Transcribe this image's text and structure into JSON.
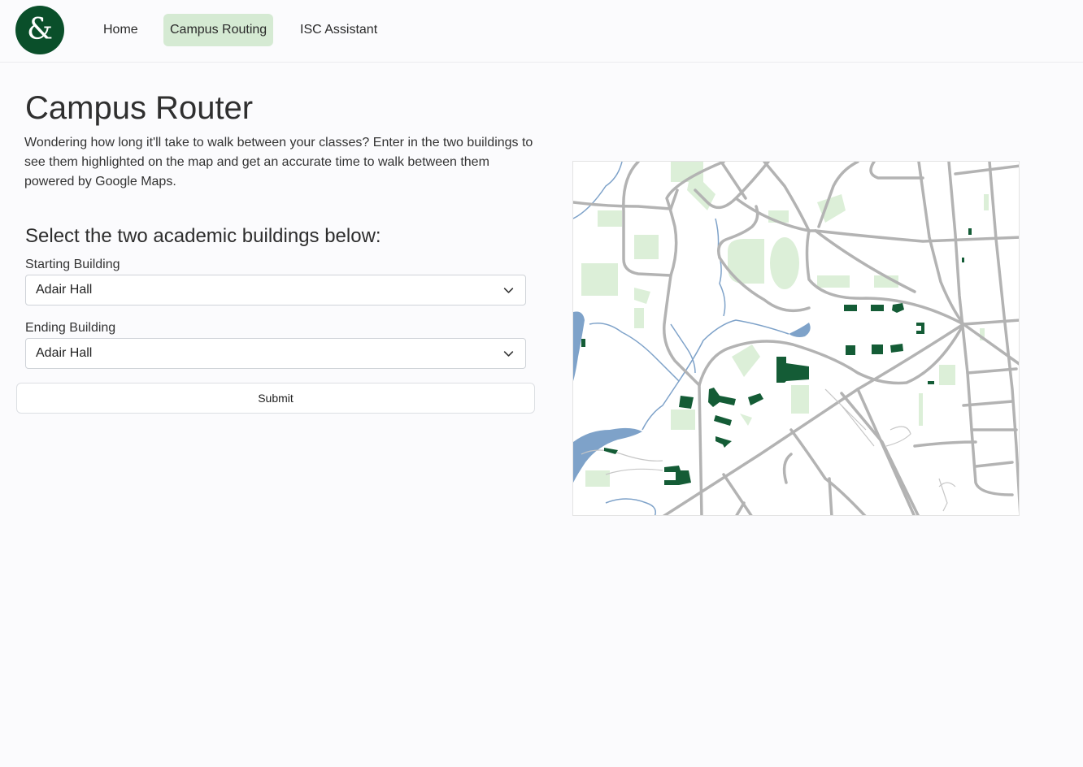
{
  "nav": {
    "logo_text": "&",
    "links": [
      {
        "label": "Home"
      },
      {
        "label": "Campus Routing"
      },
      {
        "label": "ISC Assistant"
      }
    ]
  },
  "main": {
    "title": "Campus Router",
    "intro": "Wondering how long it'll take to walk between your classes? Enter in the two buildings to see them highlighted on the map and get an accurate time to walk between them powered by Google Maps.",
    "section_heading": "Select the two academic buildings below:",
    "start": {
      "label": "Starting Building",
      "value": "Adair Hall"
    },
    "end": {
      "label": "Ending Building",
      "value": "Adair Hall"
    },
    "submit_label": "Submit"
  },
  "colors": {
    "brand": "#0a4f2a",
    "active_nav": "#d5ead3",
    "road": "#b3b3b3",
    "water": "#7ea2c9",
    "green_space": "#dcefd8",
    "highlight_building": "#145c36"
  },
  "icons": [
    "chevron-down-icon",
    "chevron-down-icon"
  ]
}
